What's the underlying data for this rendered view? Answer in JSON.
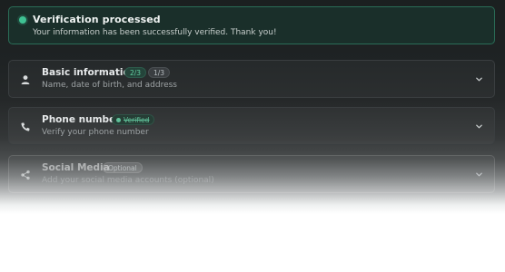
{
  "notification": {
    "title": "Verification processed",
    "message": "Your information has been successfully verified. Thank you!",
    "status_color": "#3fc293"
  },
  "sections": [
    {
      "title": "Basic information",
      "subtitle": "Name, date of birth, and address",
      "icon": "user-icon",
      "badges": [
        "2/3",
        "1/3"
      ]
    },
    {
      "title": "Phone number",
      "subtitle": "Verify your phone number",
      "icon": "phone-icon",
      "badges": [
        "Verified"
      ]
    },
    {
      "title": "Social Media",
      "subtitle": "Add your social media accounts (optional)",
      "icon": "share-icon",
      "badges": [
        "Optional"
      ]
    }
  ],
  "colors": {
    "accent_green": "#3fc293",
    "background_dark": "#1f2324"
  }
}
